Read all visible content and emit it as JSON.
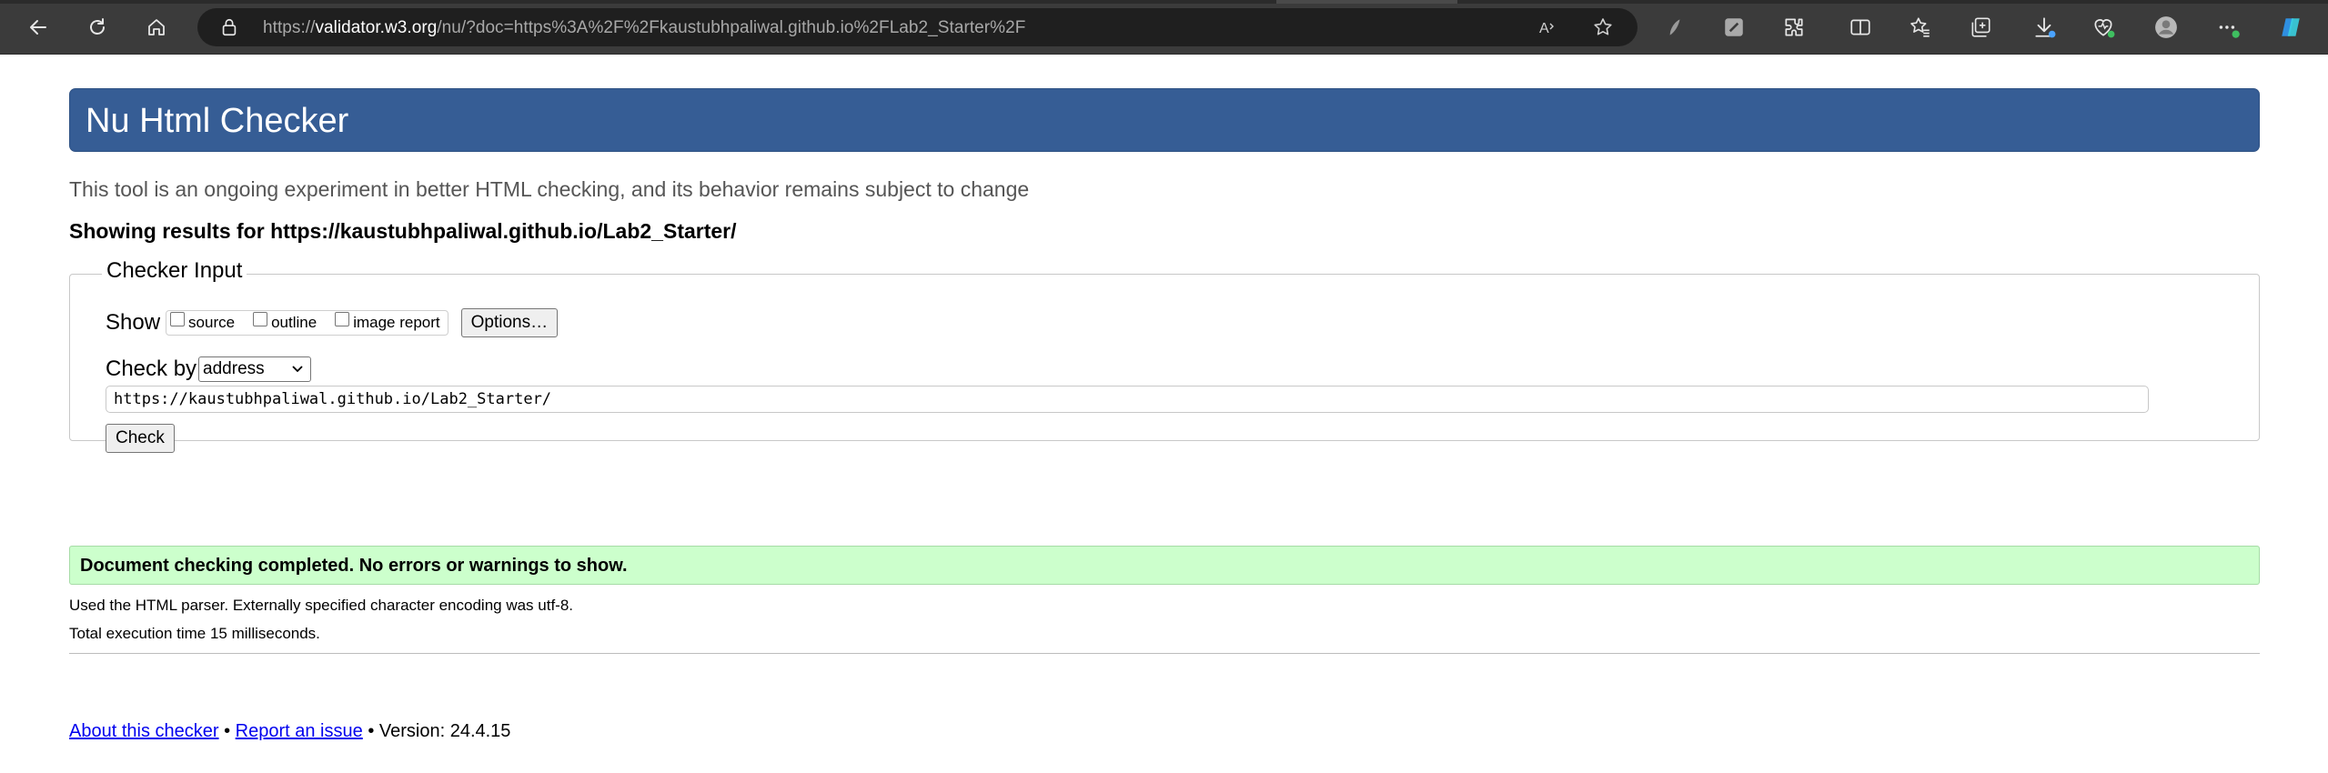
{
  "browser": {
    "url_prefix": "https://",
    "url_domain": "validator.w3.org",
    "url_path": "/nu/?doc=https%3A%2F%2Fkaustubhpaliwal.github.io%2FLab2_Starter%2F",
    "icons": [
      "back-icon",
      "refresh-icon",
      "home-icon",
      "lock-icon",
      "read-aloud-icon",
      "favorite-star-icon",
      "extension-icon",
      "split-screen-icon",
      "favorites-icon",
      "collections-icon",
      "downloads-icon",
      "browser-essentials-icon",
      "profile-icon",
      "more-icon",
      "copilot-icon"
    ],
    "accent": "#365d95"
  },
  "checker": {
    "title": "Nu Html Checker",
    "intro": "This tool is an ongoing experiment in better HTML checking, and its behavior remains subject to change",
    "showing_results": "Showing results for https://kaustubhpaliwal.github.io/Lab2_Starter/",
    "input_legend": "Checker Input",
    "show_label": "Show",
    "show_options": [
      "source",
      "outline",
      "image report"
    ],
    "options_button": "Options…",
    "check_by_label": "Check by",
    "check_by_value": "address",
    "address_value": "https://kaustubhpaliwal.github.io/Lab2_Starter/",
    "check_button": "Check"
  },
  "results": {
    "success_message": "Document checking completed. No errors or warnings to show.",
    "parser_info": "Used the HTML parser. Externally specified character encoding was utf-8.",
    "execution_time": "Total execution time 15 milliseconds.",
    "success_color": "#ccffcc"
  },
  "footer": {
    "about_link": "About this checker",
    "separator": "•",
    "report_link": "Report an issue",
    "version": "• Version: 24.4.15"
  }
}
